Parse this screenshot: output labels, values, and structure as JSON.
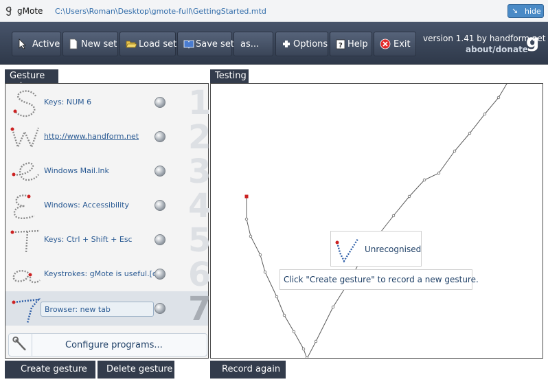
{
  "window": {
    "app_name": "gMote",
    "file_path": "C:\\Users\\Roman\\Desktop\\gmote-full\\GettingStarted.mtd",
    "hide_label": "hide"
  },
  "toolbar": {
    "buttons": [
      {
        "label": "Active",
        "icon": "cursor-icon"
      },
      {
        "label": "New set",
        "icon": "new-document-icon"
      },
      {
        "label": "Load set",
        "icon": "open-folder-icon"
      },
      {
        "label": "Save set",
        "icon": "book-icon"
      },
      {
        "label": "as...",
        "icon": ""
      },
      {
        "label": "Options",
        "icon": "plus-icon"
      },
      {
        "label": "Help",
        "icon": "help-icon"
      },
      {
        "label": "Exit",
        "icon": "exit-icon"
      }
    ],
    "version": "version 1.41 by handform.net",
    "about_link": "about/donate",
    "brand_letter": "g"
  },
  "gesture_set": {
    "title": "Gesture set",
    "items": [
      {
        "number": "1",
        "label": "Keys: NUM 6",
        "glyph": "S"
      },
      {
        "number": "2",
        "label": "http://www.handform.net",
        "glyph": "W"
      },
      {
        "number": "3",
        "label": "Windows Mail.lnk",
        "glyph": "e"
      },
      {
        "number": "4",
        "label": "Windows: Accessibility",
        "glyph": "E"
      },
      {
        "number": "5",
        "label": "Keys: Ctrl + Shift + Esc",
        "glyph": "T"
      },
      {
        "number": "6",
        "label": "Keystrokes: gMote is useful.[ctrl",
        "glyph": "a"
      },
      {
        "number": "7",
        "label": "Browser: new tab",
        "glyph": "7"
      }
    ],
    "configure_label": "Configure programs..."
  },
  "buttons": {
    "create_gesture": "Create gesture",
    "delete_gesture": "Delete gesture",
    "record_again": "Record again"
  },
  "testing": {
    "title": "Testing",
    "status": "Unrecognised",
    "hint": "Click \"Create gesture\" to record a new gesture."
  },
  "colors": {
    "toolbar_bg": "#3a4558",
    "panel_header": "#333c4c",
    "link": "#2a5a93",
    "start_dot": "#cc2222"
  }
}
